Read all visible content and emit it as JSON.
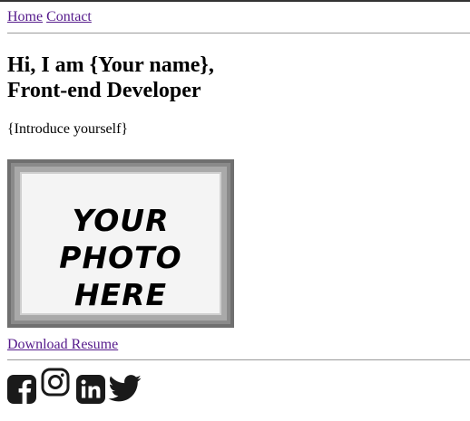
{
  "nav": {
    "home_label": "Home",
    "contact_label": "Contact"
  },
  "hero": {
    "heading_line1": "Hi, I am {Your name},",
    "heading_line2": "Front-end Developer",
    "intro": "{Introduce yourself}"
  },
  "photo": {
    "placeholder_line1": "YOUR",
    "placeholder_line2": "PHOTO",
    "placeholder_line3": "HERE"
  },
  "resume": {
    "link_label": "Download Resume"
  },
  "social": {
    "icons": [
      "facebook-icon",
      "instagram-icon",
      "linkedin-icon",
      "twitter-icon"
    ]
  },
  "colors": {
    "link": "#0000ee",
    "visited_link": "#551a8b",
    "icon": "#1a1a1a"
  }
}
